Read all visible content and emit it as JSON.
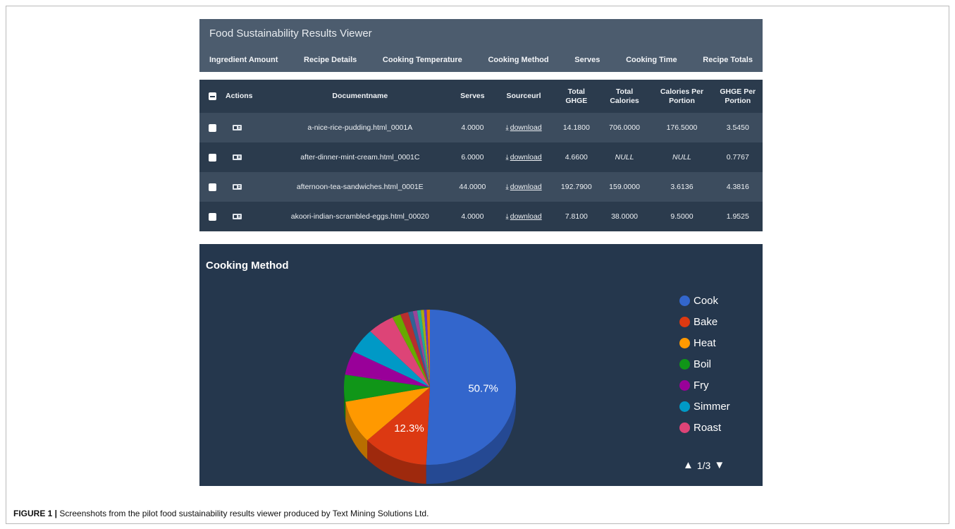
{
  "app": {
    "title": "Food Sustainability Results Viewer"
  },
  "nav": {
    "items": [
      "Ingredient Amount",
      "Recipe Details",
      "Cooking Temperature",
      "Cooking Method",
      "Serves",
      "Cooking Time",
      "Recipe Totals"
    ]
  },
  "table": {
    "headers": {
      "actions": "Actions",
      "documentname": "Documentname",
      "serves": "Serves",
      "sourceurl": "Sourceurl",
      "total_ghge_1": "Total",
      "total_ghge_2": "GHGE",
      "total_cal_1": "Total",
      "total_cal_2": "Calories",
      "cal_portion_1": "Calories Per",
      "cal_portion_2": "Portion",
      "ghge_portion_1": "GHGE Per",
      "ghge_portion_2": "Portion"
    },
    "download_label": "download",
    "download_icon": "download-icon",
    "rows": [
      {
        "documentname": "a-nice-rice-pudding.html_0001A",
        "serves": "4.0000",
        "total_ghge": "14.1800",
        "total_calories": "706.0000",
        "calories_per_portion": "176.5000",
        "ghge_per_portion": "3.5450"
      },
      {
        "documentname": "after-dinner-mint-cream.html_0001C",
        "serves": "6.0000",
        "total_ghge": "4.6600",
        "total_calories": "NULL",
        "calories_per_portion": "NULL",
        "ghge_per_portion": "0.7767"
      },
      {
        "documentname": "afternoon-tea-sandwiches.html_0001E",
        "serves": "44.0000",
        "total_ghge": "192.7900",
        "total_calories": "159.0000",
        "calories_per_portion": "3.6136",
        "ghge_per_portion": "4.3816"
      },
      {
        "documentname": "akoori-indian-scrambled-eggs.html_00020",
        "serves": "4.0000",
        "total_ghge": "7.8100",
        "total_calories": "38.0000",
        "calories_per_portion": "9.5000",
        "ghge_per_portion": "1.9525"
      }
    ]
  },
  "chart_data": {
    "type": "pie",
    "title": "Cooking Method",
    "slices": [
      {
        "name": "Cook",
        "value": 50.7,
        "color": "#3366cc"
      },
      {
        "name": "Bake",
        "value": 12.3,
        "color": "#dc3912"
      },
      {
        "name": "Heat",
        "value": 9.0,
        "color": "#ff9900"
      },
      {
        "name": "Boil",
        "value": 5.6,
        "color": "#109618"
      },
      {
        "name": "Fry",
        "value": 5.0,
        "color": "#990099"
      },
      {
        "name": "Simmer",
        "value": 5.2,
        "color": "#0099c6"
      },
      {
        "name": "Roast",
        "value": 5.0,
        "color": "#dd4477"
      },
      {
        "name": "",
        "value": 1.6,
        "color": "#66aa00"
      },
      {
        "name": "",
        "value": 1.5,
        "color": "#b82e2e"
      },
      {
        "name": "",
        "value": 0.9,
        "color": "#316395"
      },
      {
        "name": "",
        "value": 0.8,
        "color": "#994499"
      },
      {
        "name": "",
        "value": 0.7,
        "color": "#22aa99"
      },
      {
        "name": "",
        "value": 0.6,
        "color": "#aaaa11"
      },
      {
        "name": "",
        "value": 0.5,
        "color": "#6633cc"
      },
      {
        "name": "",
        "value": 0.6,
        "color": "#e67300"
      }
    ],
    "labels_shown": [
      "50.7%",
      "12.3%"
    ],
    "legend": [
      "Cook",
      "Bake",
      "Heat",
      "Boil",
      "Fry",
      "Simmer",
      "Roast"
    ],
    "legend_position": "right",
    "three_d": true
  },
  "pager": {
    "text": "1/3"
  },
  "caption": {
    "label": "FIGURE 1 |",
    "text": " Screenshots from the pilot food sustainability results viewer produced by Text Mining Solutions Ltd."
  }
}
